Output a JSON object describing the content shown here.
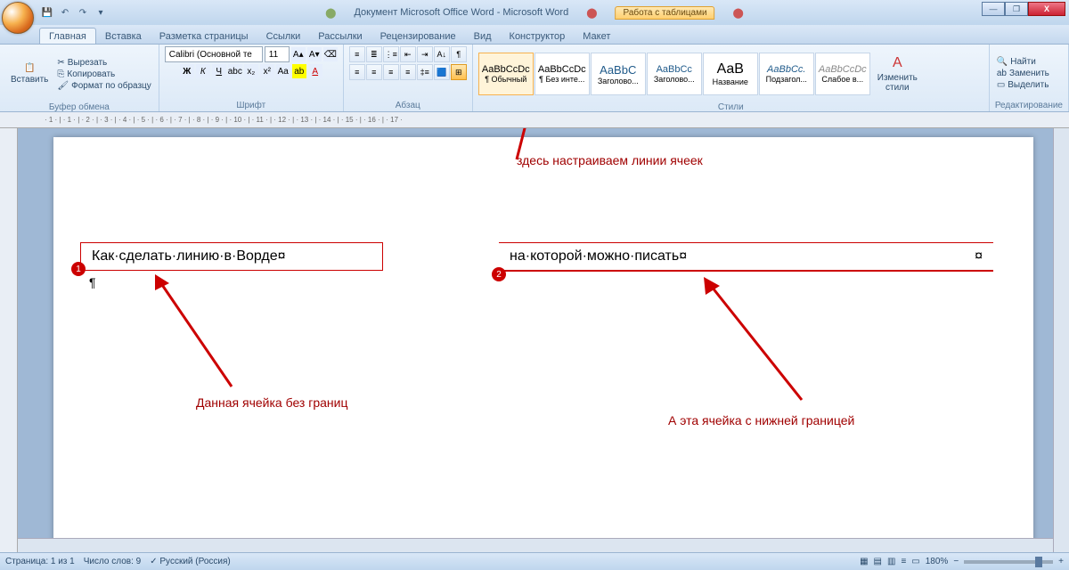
{
  "title": {
    "doc": "Документ Microsoft Office Word - Microsoft Word",
    "tools": "Работа с таблицами"
  },
  "tabs": [
    "Главная",
    "Вставка",
    "Разметка страницы",
    "Ссылки",
    "Рассылки",
    "Рецензирование",
    "Вид",
    "Конструктор",
    "Макет"
  ],
  "clipboard": {
    "paste": "Вставить",
    "cut": "Вырезать",
    "copy": "Копировать",
    "format": "Формат по образцу",
    "group": "Буфер обмена"
  },
  "font": {
    "name": "Calibri (Основной те",
    "size": "11",
    "group": "Шрифт"
  },
  "paragraph": {
    "group": "Абзац"
  },
  "styles": {
    "group": "Стили",
    "items": [
      {
        "prev": "AaBbCcDc",
        "label": "¶ Обычный"
      },
      {
        "prev": "AaBbCcDc",
        "label": "¶ Без инте..."
      },
      {
        "prev": "AaBbC",
        "label": "Заголово..."
      },
      {
        "prev": "AaBbCc",
        "label": "Заголово..."
      },
      {
        "prev": "AaB",
        "label": "Название"
      },
      {
        "prev": "AaBbCc.",
        "label": "Подзагол..."
      },
      {
        "prev": "AaBbCcDc",
        "label": "Слабое в..."
      }
    ],
    "change": "Изменить\nстили"
  },
  "editing": {
    "find": "Найти",
    "replace": "Заменить",
    "select": "Выделить",
    "group": "Редактирование"
  },
  "annotations": {
    "top": "здесь настраиваем линии ячеек",
    "cell1": "Как·сделать·линию·в·Ворде¤",
    "cell2": "на·которой·можно·писать¤",
    "end": "¤",
    "para": "¶",
    "left": "Данная ячейка без границ",
    "right": "А эта ячейка с нижней границей"
  },
  "status": {
    "page": "Страница: 1 из 1",
    "words": "Число слов: 9",
    "lang": "Русский (Россия)",
    "zoom": "180%"
  }
}
